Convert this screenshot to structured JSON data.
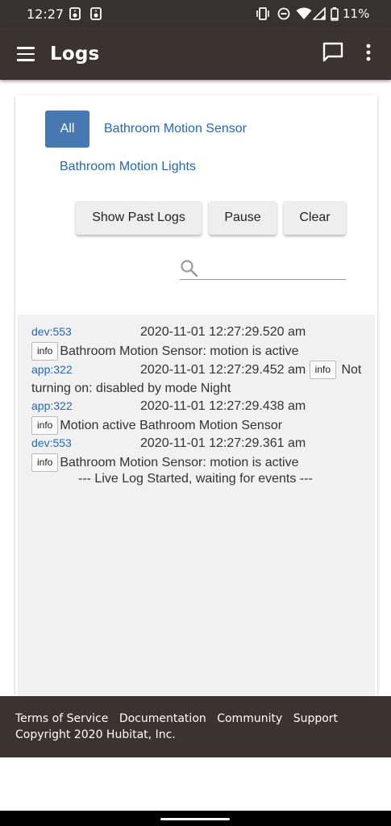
{
  "status_bar": {
    "time": "12:27",
    "battery": "11%"
  },
  "app_bar": {
    "title": "Logs"
  },
  "filters": {
    "all": "All",
    "sensor": "Bathroom Motion Sensor",
    "lights": "Bathroom Motion Lights"
  },
  "actions": {
    "past_logs": "Show Past Logs",
    "pause": "Pause",
    "clear": "Clear"
  },
  "search": {
    "placeholder": ""
  },
  "logs": [
    {
      "source": "dev:553",
      "time": "2020-11-01 12:27:29.520 am",
      "level": "info",
      "message": "Bathroom Motion Sensor: motion is active"
    },
    {
      "source": "app:322",
      "time": "2020-11-01 12:27:29.452 am",
      "level": "info",
      "message": "Not turning on: disabled by mode Night"
    },
    {
      "source": "app:322",
      "time": "2020-11-01 12:27:29.438 am",
      "level": "info",
      "message": "Motion active Bathroom Motion Sensor"
    },
    {
      "source": "dev:553",
      "time": "2020-11-01 12:27:29.361 am",
      "level": "info",
      "message": "Bathroom Motion Sensor: motion is active"
    }
  ],
  "live_log_message": "--- Live Log Started, waiting for events ---",
  "footer": {
    "links": [
      "Terms of Service",
      "Documentation",
      "Community",
      "Support"
    ],
    "copyright": "Copyright 2020 Hubitat, Inc."
  },
  "colors": {
    "app_bar": "#3a3330",
    "accent": "#4678b2",
    "link": "#2468b8",
    "log_bg": "#f1f1f1"
  }
}
